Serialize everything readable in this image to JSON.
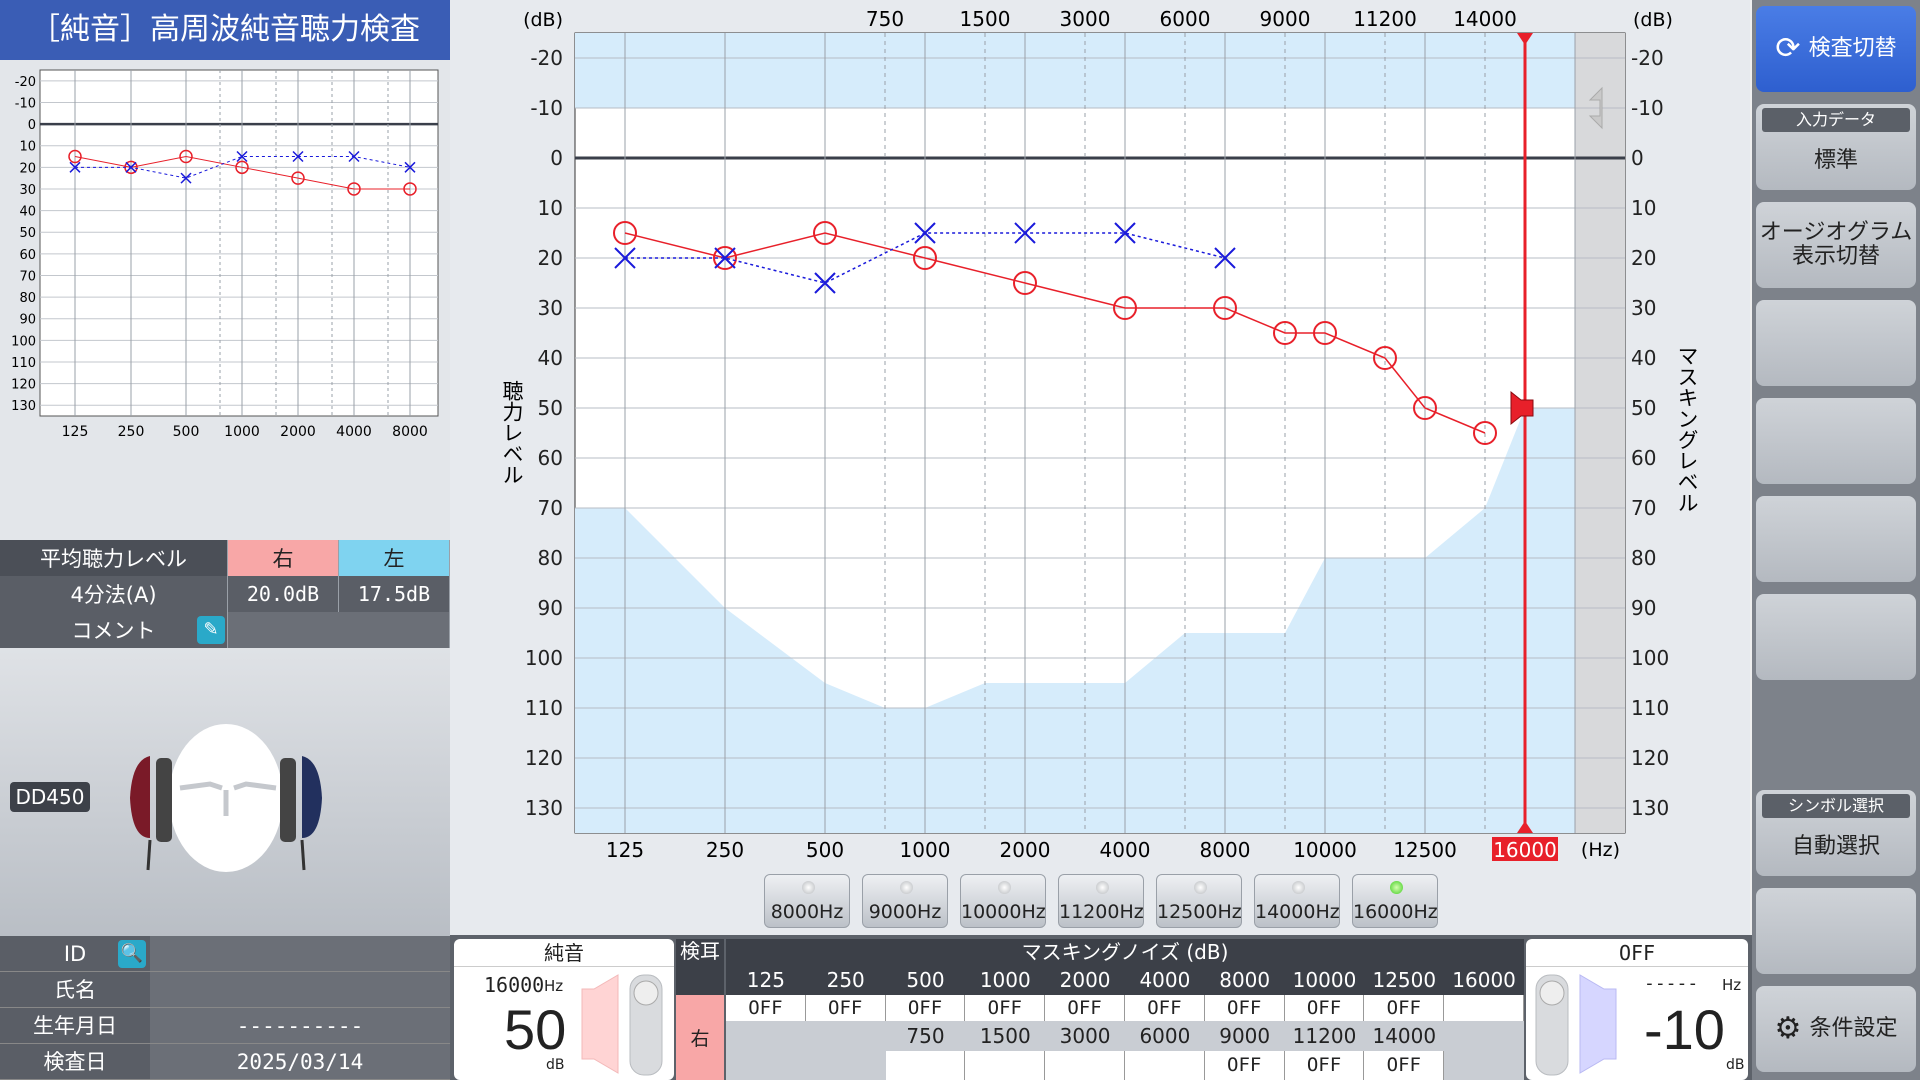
{
  "title": "［純音］高周波純音聴力検査",
  "mini": {
    "yticks": [
      "-20",
      "-10",
      "0",
      "10",
      "20",
      "30",
      "40",
      "50",
      "60",
      "70",
      "80",
      "90",
      "100",
      "110",
      "120",
      "130"
    ],
    "xticks": [
      "125",
      "250",
      "500",
      "1000",
      "2000",
      "4000",
      "8000"
    ]
  },
  "summary": {
    "avg_label": "平均聴力レベル",
    "right_label": "右",
    "left_label": "左",
    "method_label": "4分法(A)",
    "right_value": "20.0dB",
    "left_value": "17.5dB",
    "comment_label": "コメント"
  },
  "device": "DD450",
  "info": {
    "id_label": "ID",
    "name_label": "氏名",
    "birth_label": "生年月日",
    "birth_value": "----------",
    "date_label": "検査日",
    "date_value": "2025/03/14"
  },
  "chart_data": {
    "type": "line",
    "title": "",
    "ylabel": "聴力レベル",
    "ylabel_right": "マスキングレベル",
    "yunit": "(dB)",
    "xunit": "(Hz)",
    "ylim": [
      -25,
      135
    ],
    "yticks": [
      "-20",
      "-10",
      "0",
      "10",
      "20",
      "30",
      "40",
      "50",
      "60",
      "70",
      "80",
      "90",
      "100",
      "110",
      "120",
      "130"
    ],
    "x_bottom": [
      "125",
      "250",
      "500",
      "1000",
      "2000",
      "4000",
      "8000",
      "10000",
      "12500",
      "16000"
    ],
    "x_top": [
      "750",
      "1500",
      "3000",
      "6000",
      "9000",
      "11200",
      "14000"
    ],
    "series": [
      {
        "color": "#e8202a",
        "marker": "circle",
        "points": [
          [
            "125",
            15
          ],
          [
            "250",
            20
          ],
          [
            "500",
            15
          ],
          [
            "1000",
            20
          ],
          [
            "2000",
            25
          ],
          [
            "4000",
            30
          ],
          [
            "8000",
            30
          ],
          [
            "9000",
            35
          ],
          [
            "10000",
            35
          ],
          [
            "11200",
            40
          ],
          [
            "12500",
            50
          ],
          [
            "14000",
            55
          ]
        ]
      },
      {
        "color": "#1a1adb",
        "marker": "cross",
        "points": [
          [
            "125",
            20
          ],
          [
            "250",
            20
          ],
          [
            "500",
            25
          ],
          [
            "1000",
            15
          ],
          [
            "2000",
            15
          ],
          [
            "4000",
            15
          ],
          [
            "8000",
            20
          ]
        ]
      }
    ],
    "cursor_freq": "16000",
    "cursor_level": 50
  },
  "freq_buttons": [
    {
      "label": "8000Hz",
      "on": false
    },
    {
      "label": "9000Hz",
      "on": false
    },
    {
      "label": "10000Hz",
      "on": false
    },
    {
      "label": "11200Hz",
      "on": false
    },
    {
      "label": "12500Hz",
      "on": false
    },
    {
      "label": "14000Hz",
      "on": false
    },
    {
      "label": "16000Hz",
      "on": true
    }
  ],
  "pure": {
    "title": "純音",
    "freq": "16000",
    "freq_unit": "Hz",
    "level": "50",
    "unit": "dB"
  },
  "mask": {
    "ear_label": "検耳",
    "ear": "右",
    "header": "マスキングノイズ (dB)",
    "row1": [
      "125",
      "250",
      "500",
      "1000",
      "2000",
      "4000",
      "8000",
      "10000",
      "12500",
      "16000"
    ],
    "row1_vals": [
      "OFF",
      "OFF",
      "OFF",
      "OFF",
      "OFF",
      "OFF",
      "OFF",
      "OFF",
      "OFF",
      ""
    ],
    "row2": [
      "750",
      "1500",
      "3000",
      "6000",
      "9000",
      "11200",
      "14000"
    ],
    "row2_vals": [
      "",
      "",
      "",
      "",
      "OFF",
      "OFF",
      "OFF"
    ]
  },
  "noise": {
    "title": "OFF",
    "freq": "-----",
    "freq_unit": "Hz",
    "level": "-10",
    "unit": "dB"
  },
  "buttons": {
    "switch_test": "検査切替",
    "input_cap": "入力データ",
    "input_val": "標準",
    "audiogram": "オージオグラム\n表示切替",
    "symbol_cap": "シンボル選択",
    "symbol_val": "自動選択",
    "settings": "条件設定"
  }
}
